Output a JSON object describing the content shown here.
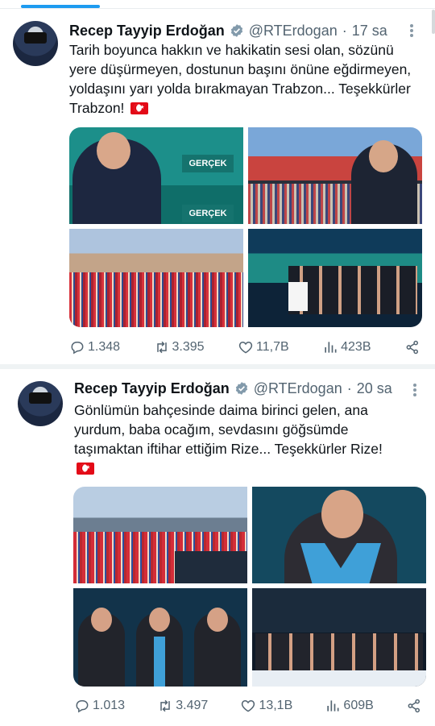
{
  "tweets": [
    {
      "author_name": "Recep Tayyip Erdoğan",
      "handle": "@RTErdogan",
      "separator": "·",
      "time": "17 sa",
      "text": "Tarih boyunca hakkın ve hakikatin sesi olan, sözünü yere düşürmeyen, dostunun başını önüne eğdirmeyen, yoldaşını yarı yolda bırakmayan Trabzon... Teşekkürler Trabzon!",
      "photo_signs": [
        "GERÇEK",
        "GERÇEK"
      ],
      "replies": "1.348",
      "reposts": "3.395",
      "likes": "11,7B",
      "views": "423B"
    },
    {
      "author_name": "Recep Tayyip Erdoğan",
      "handle": "@RTErdogan",
      "separator": "·",
      "time": "20 sa",
      "text": "Gönlümün bahçesinde daima birinci gelen, ana yurdum, baba ocağım, sevdasını göğsümde taşımaktan iftihar ettiğim Rize... Teşekkürler Rize!",
      "replies": "1.013",
      "reposts": "3.497",
      "likes": "13,1B",
      "views": "609B"
    }
  ],
  "icons": {
    "verified": "verified-badge-icon",
    "more": "more-options-icon",
    "reply": "reply-icon",
    "repost": "repost-icon",
    "like": "like-icon",
    "views": "views-icon",
    "share": "share-icon"
  },
  "colors": {
    "accent": "#1d9bf0",
    "text": "#0f1419",
    "muted": "#536471",
    "flag_red": "#e30a17"
  }
}
